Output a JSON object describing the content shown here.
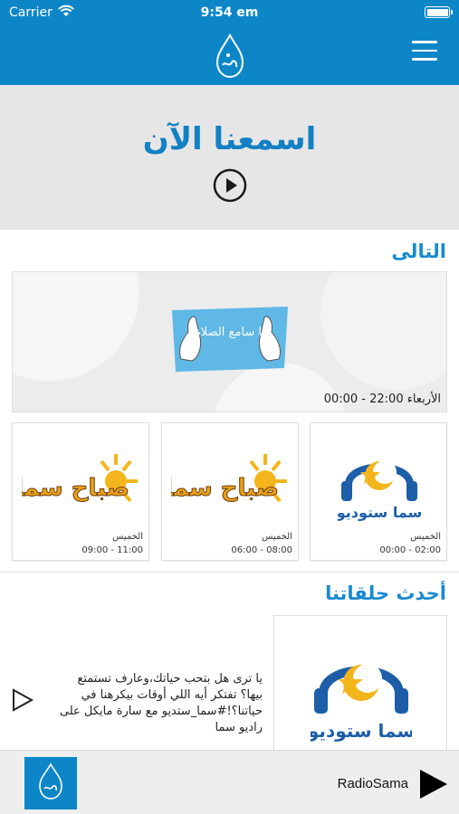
{
  "status_bar": {
    "carrier": "Carrier",
    "time": "9:54 em"
  },
  "header": {
    "menu_icon": "hamburger-menu-icon",
    "logo_icon": "radio-sama-drop-logo"
  },
  "listen_now": {
    "title": "اسمعنا الآن",
    "play_icon": "play-circle-icon"
  },
  "next_section": {
    "title": "التالى",
    "featured": {
      "image_text": "يا سامع الصلاة",
      "time": "الأربعاء 22:00 - 00:00"
    },
    "cards": [
      {
        "image_text": "صباح سما",
        "day": "الخميس",
        "hours": "09:00 - 11:00"
      },
      {
        "image_text": "صباح سما",
        "day": "الخميس",
        "hours": "06:00 - 08:00"
      },
      {
        "image_text": "سما ستوديو",
        "day": "الخميس",
        "hours": "00:00 - 02:00"
      }
    ]
  },
  "latest_section": {
    "title": "أحدث حلقاتنا",
    "episode": {
      "description": "يا ترى هل بتحب حياتك،وعارف تستمتع بيها؟ تفتكر أيه اللي أوقات بيكرهنا في حياتنا؟!#سما_ستديو مع سارة مايكل على راديو سما",
      "image_text": "سما ستوديو",
      "play_icon": "play-outline-icon"
    }
  },
  "player": {
    "station": "RadioSama",
    "play_icon": "play-icon"
  },
  "colors": {
    "primary": "#0d86c8",
    "title": "#1380c4",
    "sun": "#f3b51b",
    "sama_text": "#1e5ea8"
  }
}
